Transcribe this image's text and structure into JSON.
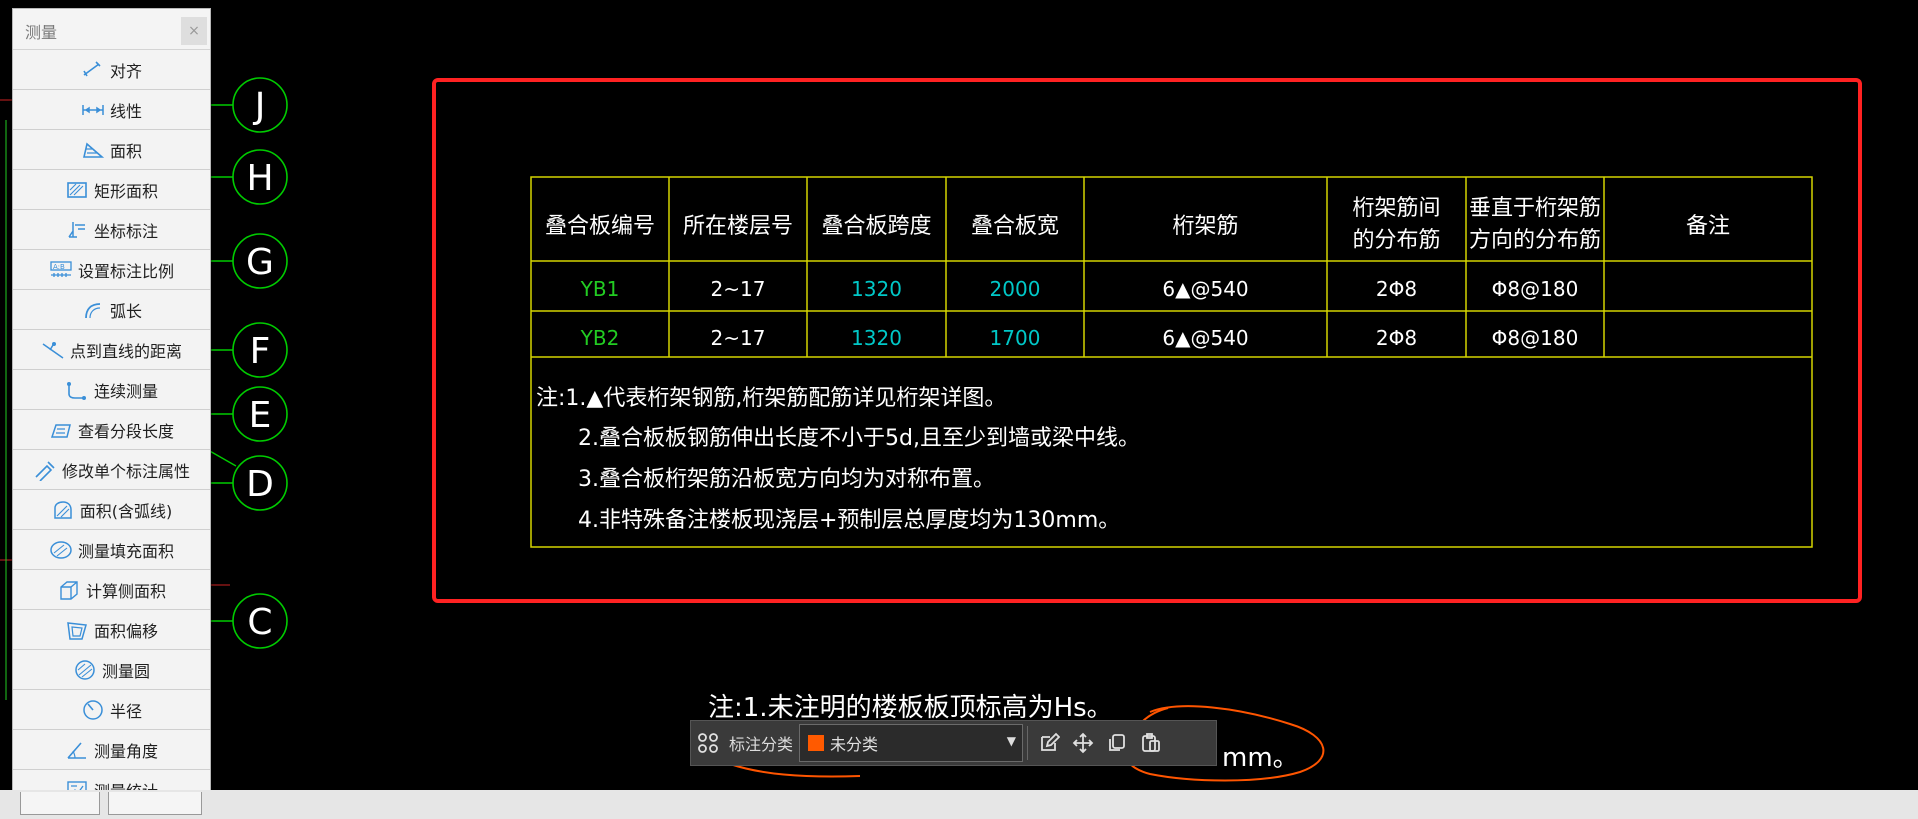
{
  "panel": {
    "title": "测量",
    "close_label": "×",
    "tools": [
      {
        "id": "align",
        "label": "对齐",
        "icon": "align-dimension-icon"
      },
      {
        "id": "linear",
        "label": "线性",
        "icon": "linear-dimension-icon"
      },
      {
        "id": "area",
        "label": "面积",
        "icon": "area-icon"
      },
      {
        "id": "rect-area",
        "label": "矩形面积",
        "icon": "rectangle-area-icon"
      },
      {
        "id": "coord",
        "label": "坐标标注",
        "icon": "coordinate-icon"
      },
      {
        "id": "scale",
        "label": "设置标注比例",
        "icon": "scale-icon"
      },
      {
        "id": "arc",
        "label": "弧长",
        "icon": "arc-length-icon"
      },
      {
        "id": "point-line",
        "label": "点到直线的距离",
        "icon": "point-line-distance-icon"
      },
      {
        "id": "continuous",
        "label": "连续测量",
        "icon": "continuous-measure-icon"
      },
      {
        "id": "segment",
        "label": "查看分段长度",
        "icon": "segment-length-icon"
      },
      {
        "id": "modify",
        "label": "修改单个标注属性",
        "icon": "modify-dimension-icon"
      },
      {
        "id": "area-arc",
        "label": "面积(含弧线)",
        "icon": "area-arc-icon"
      },
      {
        "id": "fill-area",
        "label": "测量填充面积",
        "icon": "fill-area-icon"
      },
      {
        "id": "side-area",
        "label": "计算侧面积",
        "icon": "side-area-icon"
      },
      {
        "id": "area-offset",
        "label": "面积偏移",
        "icon": "area-offset-icon"
      },
      {
        "id": "circle",
        "label": "测量圆",
        "icon": "measure-circle-icon"
      },
      {
        "id": "radius",
        "label": "半径",
        "icon": "radius-icon"
      },
      {
        "id": "angle",
        "label": "测量角度",
        "icon": "angle-icon"
      },
      {
        "id": "stats",
        "label": "测量统计",
        "icon": "statistics-icon"
      }
    ]
  },
  "grid_axes": [
    "J",
    "H",
    "G",
    "F",
    "E",
    "D",
    "C"
  ],
  "table": {
    "headers": [
      [
        "叠合板编号"
      ],
      [
        "所在楼层号"
      ],
      [
        "叠合板跨度"
      ],
      [
        "叠合板宽"
      ],
      [
        "桁架筋"
      ],
      [
        "桁架筋间",
        "的分布筋"
      ],
      [
        "垂直于桁架筋",
        "方向的分布筋"
      ],
      [
        "备注"
      ]
    ],
    "rows": [
      [
        "YB1",
        "2~17",
        "1320",
        "2000",
        "6▲@540",
        "2Φ8",
        "Φ8@180",
        ""
      ],
      [
        "YB2",
        "2~17",
        "1320",
        "1700",
        "6▲@540",
        "2Φ8",
        "Φ8@180",
        ""
      ]
    ],
    "notes": [
      "注:1.▲代表桁架钢筋,桁架筋配筋详见桁架详图。",
      "2.叠合板板钢筋伸出长度不小于5d,且至少到墙或梁中线。",
      "3.叠合板桁架筋沿板宽方向均为对称布置。",
      "4.非特殊备注楼板现浇层+预制层总厚度均为130mm。"
    ]
  },
  "bottom_note": {
    "line1": "注:1.未注明的楼板板顶标高为Hs。",
    "line2_tail": "mm。"
  },
  "toolbar": {
    "grid_icon": "grid-layout-icon",
    "label": "标注分类",
    "category_value": "未分类",
    "category_color": "#ff5a00",
    "actions": [
      "edit-icon",
      "move-icon",
      "copy-icon",
      "paste-icon"
    ]
  },
  "colors": {
    "table_line": "#d4d400",
    "green": "#22cc22",
    "cyan": "#00c8c8",
    "white": "#ffffff",
    "highlight": "#ff2222",
    "annotation": "#ff5500",
    "axis": "#00cc00"
  }
}
